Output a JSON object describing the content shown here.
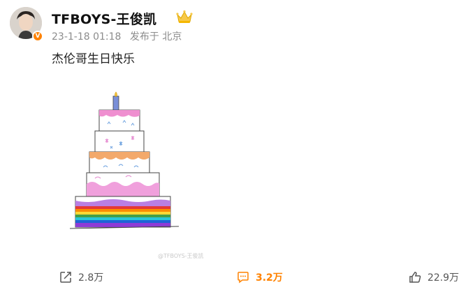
{
  "post": {
    "author": "TFBOYS-王俊凯",
    "timestamp": "23-1-18 01:18",
    "source": "发布于 北京",
    "text": "杰伦哥生日快乐",
    "watermark": "@TFBOYS-王俊凯"
  },
  "actions": {
    "repost_count": "2.8万",
    "comment_count": "3.2万",
    "like_count": "22.9万"
  },
  "colors": {
    "verified": "#ff8200",
    "active_action": "#ff8200",
    "muted_text": "#8c8c8c"
  },
  "icons": {
    "repost": "share-icon",
    "comment": "comment-icon",
    "like": "thumbs-up-icon",
    "author_badge": "crown-icon"
  }
}
